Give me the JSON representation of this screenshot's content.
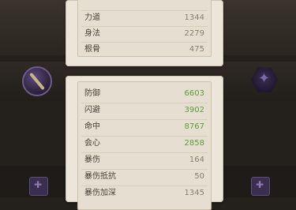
{
  "top_stats": [
    {
      "label": "",
      "value": ""
    },
    {
      "label": "力道",
      "value": "1344"
    },
    {
      "label": "身法",
      "value": "2279"
    },
    {
      "label": "根骨",
      "value": "475"
    }
  ],
  "bottom_stats": [
    {
      "label": "防御",
      "value": "6603",
      "highlight": true
    },
    {
      "label": "闪避",
      "value": "3902",
      "highlight": true
    },
    {
      "label": "命中",
      "value": "8767",
      "highlight": true
    },
    {
      "label": "会心",
      "value": "2858",
      "highlight": true
    },
    {
      "label": "暴伤",
      "value": "164",
      "highlight": false
    },
    {
      "label": "暴伤抵抗",
      "value": "50",
      "highlight": false
    },
    {
      "label": "暴伤加深",
      "value": "1345",
      "highlight": false
    }
  ],
  "colors": {
    "value_green": "#5f9a3a",
    "value_gray": "#8a7e6e",
    "panel_bg": "#ece6da"
  }
}
